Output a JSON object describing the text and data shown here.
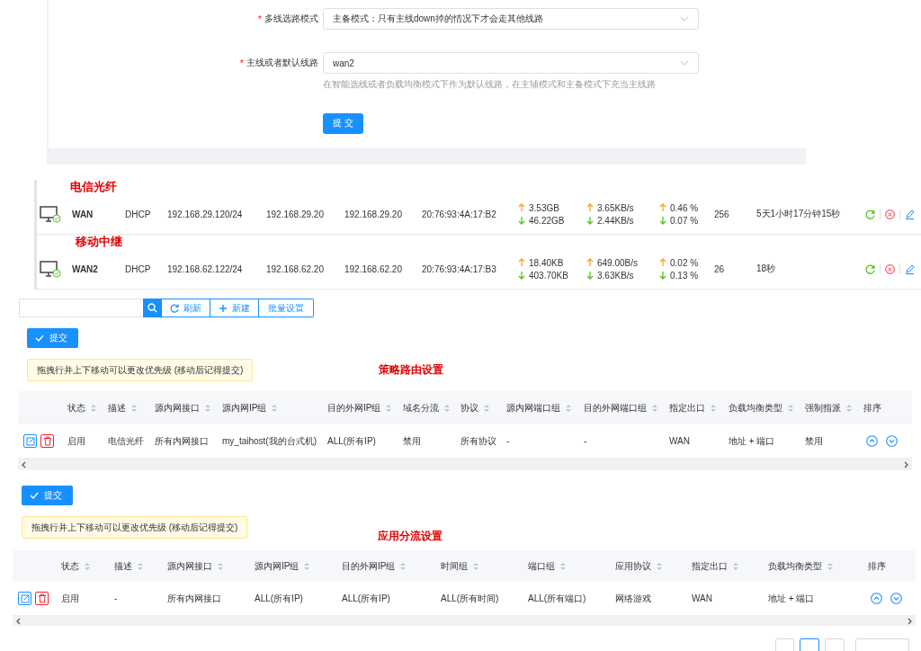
{
  "mode_form": {
    "fields": [
      {
        "label": "多线选路模式",
        "required_mark": "*",
        "value": "主备模式：只有主线down掉的情况下才会走其他线路"
      },
      {
        "label": "主线或者默认线路",
        "required_mark": "*",
        "value": "wan2",
        "hint": "在智能选线或者负载均衡模式下作为默认线路，在主辅模式和主备模式下充当主线路"
      }
    ],
    "submit": "提 交"
  },
  "wan_list": {
    "items": [
      {
        "annotation": "电信光纤",
        "name": "WAN",
        "protocol": "DHCP",
        "ip": "192.168.29.120/24",
        "gateway": "192.168.29.20",
        "dns": "192.168.29.20",
        "mac": "20:76:93:4A:17:B2",
        "upload_total": "3.53GB",
        "download_total": "46.22GB",
        "upload_speed": "3.65KB/s",
        "download_speed": "2.44KB/s",
        "upload_pct": "0.46 %",
        "download_pct": "0.07 %",
        "connections": "256",
        "uptime": "5天1小时17分钟15秒"
      },
      {
        "annotation": "移动中继",
        "name": "WAN2",
        "protocol": "DHCP",
        "ip": "192.168.62.122/24",
        "gateway": "192.168.62.20",
        "dns": "192.168.62.20",
        "mac": "20:76:93:4A:17:B3",
        "upload_total": "18.40KB",
        "download_total": "403.70KB",
        "upload_speed": "649.00B/s",
        "download_speed": "3.63KB/s",
        "upload_pct": "0.02 %",
        "download_pct": "0.13 %",
        "connections": "26",
        "uptime": "18秒"
      }
    ]
  },
  "toolbar": {
    "buttons": [
      {
        "label": "刷新",
        "kind": "refresh"
      },
      {
        "label": "新建",
        "kind": "add"
      },
      {
        "label": "批量设置",
        "kind": "plain"
      }
    ]
  },
  "policy_routing": {
    "submit": "提交",
    "notice": "拖拽行并上下移动可以更改优先级 (移动后记得提交)",
    "title": "策略路由设置",
    "columns": [
      {
        "label": "状态",
        "sortable": true
      },
      {
        "label": "描述",
        "sortable": true
      },
      {
        "label": "源内网接口",
        "sortable": true
      },
      {
        "label": "源内网IP组",
        "sortable": true
      },
      {
        "label": "目的外网IP组",
        "sortable": true
      },
      {
        "label": "域名分流",
        "sortable": true
      },
      {
        "label": "协议",
        "sortable": true
      },
      {
        "label": "源内网端口组",
        "sortable": true
      },
      {
        "label": "目的外网端口组",
        "sortable": true
      },
      {
        "label": "指定出口",
        "sortable": true
      },
      {
        "label": "负载均衡类型",
        "sortable": true
      },
      {
        "label": "强制指派",
        "sortable": true
      },
      {
        "label": "排序",
        "sortable": false
      }
    ],
    "rows": [
      {
        "cells": [
          "启用",
          "电信光纤",
          "所有内网接口",
          "my_taihost(我的台式机)",
          "ALL(所有IP)",
          "禁用",
          "所有协议",
          "-",
          "-",
          "WAN",
          "地址 + 端口",
          "禁用"
        ]
      }
    ]
  },
  "app_split": {
    "submit": "提交",
    "notice": "拖拽行并上下移动可以更改优先级 (移动后记得提交)",
    "title": "应用分流设置",
    "columns": [
      {
        "label": "状态",
        "sortable": true
      },
      {
        "label": "描述",
        "sortable": true
      },
      {
        "label": "源内网接口",
        "sortable": true
      },
      {
        "label": "源内网IP组",
        "sortable": true
      },
      {
        "label": "目的外网IP组",
        "sortable": true
      },
      {
        "label": "时间组",
        "sortable": true
      },
      {
        "label": "端口组",
        "sortable": true
      },
      {
        "label": "应用协议",
        "sortable": true
      },
      {
        "label": "指定出口",
        "sortable": true
      },
      {
        "label": "负载均衡类型",
        "sortable": true
      },
      {
        "label": "排序",
        "sortable": false
      }
    ],
    "rows": [
      {
        "cells": [
          "启用",
          "-",
          "所有内网接口",
          "ALL(所有IP)",
          "ALL(所有IP)",
          "ALL(所有时间)",
          "ALL(所有端口)",
          "网络游戏",
          "WAN",
          "地址 + 端口"
        ]
      }
    ]
  }
}
